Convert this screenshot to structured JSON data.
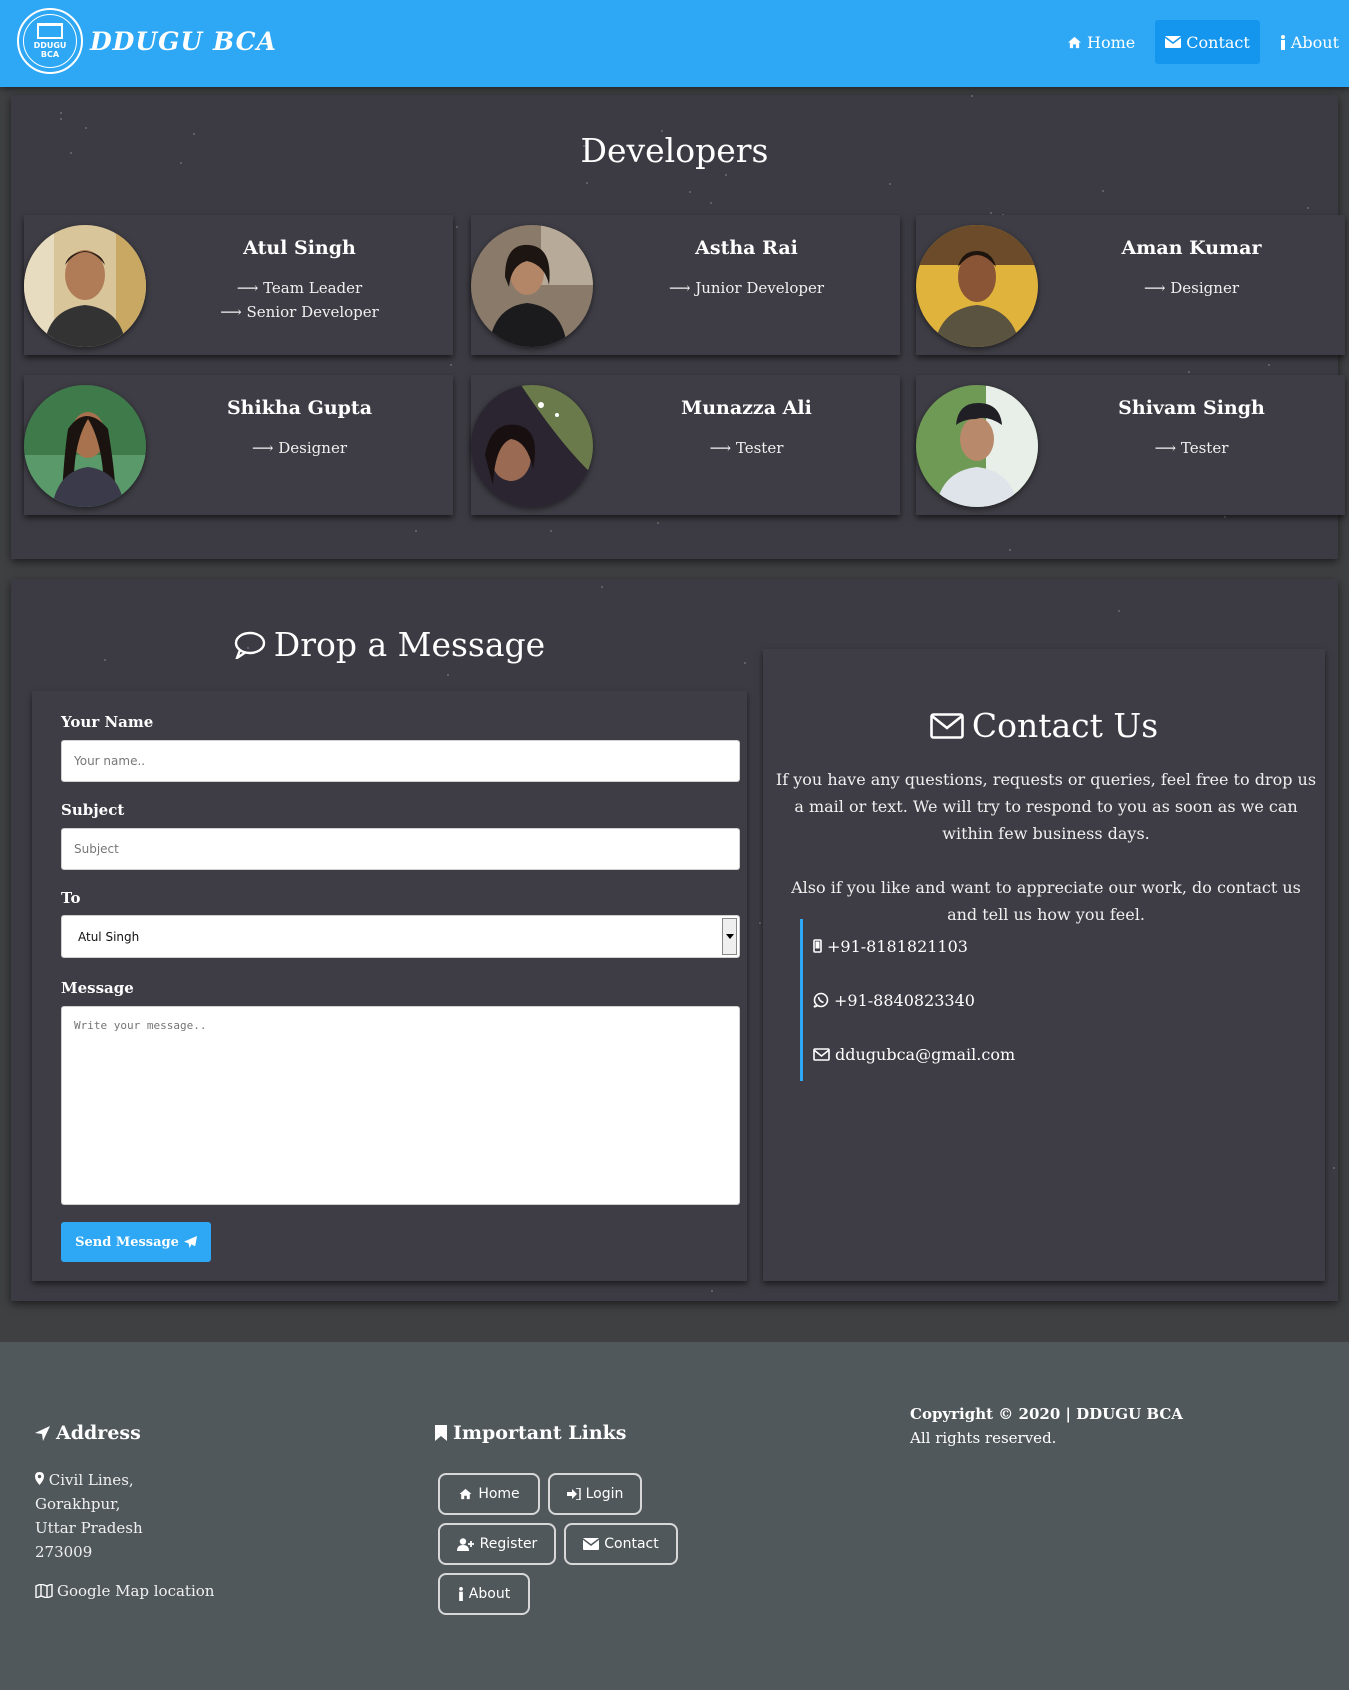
{
  "navbar": {
    "logo_text_line1": "DDUGU",
    "logo_text_line2": "BCA",
    "brand": "DDUGU BCA",
    "links": [
      {
        "label": "Home",
        "icon": "home-icon",
        "active": false
      },
      {
        "label": "Contact",
        "icon": "envelope-icon",
        "active": true
      },
      {
        "label": "About",
        "icon": "info-icon",
        "active": false
      }
    ]
  },
  "developers": {
    "title": "Developers",
    "people": [
      {
        "name": "Atul Singh",
        "roles": [
          "Team Leader",
          "Senior Developer"
        ],
        "avatar_color": "#c9a86b"
      },
      {
        "name": "Astha Rai",
        "roles": [
          "Junior Developer"
        ],
        "avatar_color": "#6f5a4a"
      },
      {
        "name": "Aman Kumar",
        "roles": [
          "Designer"
        ],
        "avatar_color": "#d4a73a"
      },
      {
        "name": "Shikha Gupta",
        "roles": [
          "Designer"
        ],
        "avatar_color": "#3f7a4a"
      },
      {
        "name": "Munazza Ali",
        "roles": [
          "Tester"
        ],
        "avatar_color": "#5a4a42"
      },
      {
        "name": "Shivam Singh",
        "roles": [
          "Tester"
        ],
        "avatar_color": "#5f8a4a"
      }
    ]
  },
  "message_form": {
    "title": "Drop a Message",
    "name_label": "Your Name",
    "name_placeholder": "Your name..",
    "subject_label": "Subject",
    "subject_placeholder": "Subject",
    "to_label": "To",
    "to_selected": "Atul Singh",
    "message_label": "Message",
    "message_placeholder": "Write your message..",
    "send_label": "Send Message"
  },
  "contact": {
    "title": "Contact Us",
    "paragraph1": "If you have any questions, requests or queries, feel free to drop us a mail or text. We will try to respond to you as soon as we can within few business days.",
    "paragraph2": "Also if you like and want to appreciate our work, do contact us and tell us how you feel.",
    "phone": "+91-8181821103",
    "whatsapp": "+91-8840823340",
    "email": "ddugubca@gmail.com"
  },
  "footer": {
    "address_heading": "Address",
    "address_lines": [
      "Civil Lines,",
      "Gorakhpur,",
      "Uttar Pradesh",
      "273009"
    ],
    "map_link": "Google Map location",
    "links_heading": "Important Links",
    "links": {
      "home": "Home",
      "login": "Login",
      "register": "Register",
      "contact": "Contact",
      "about": "About"
    },
    "copyright": "Copyright © 2020 | DDUGU BCA",
    "rights": "All rights reserved."
  },
  "colors": {
    "accent": "#2ea7f4",
    "section_bg": "#3c3b43",
    "footer_bg": "#51585c"
  }
}
